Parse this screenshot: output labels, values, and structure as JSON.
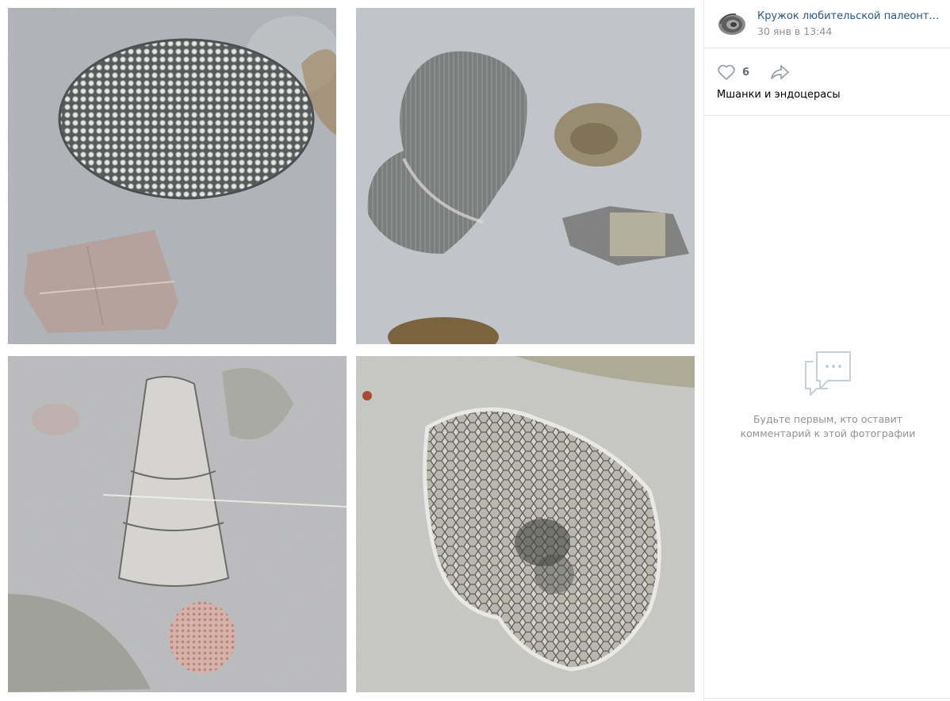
{
  "post": {
    "author": "Кружок любительской палеонтоло...",
    "date": "30 янв в 13:44",
    "likes": "6",
    "caption": "Мшанки и эндоцерасы"
  },
  "comments": {
    "empty_text": "Будьте первым, кто оставит комментарий к этой фотографии"
  },
  "icons": {
    "like": "heart-icon",
    "share": "share-arrow-icon",
    "comments_empty": "chat-bubble-icon",
    "avatar": "ammonite-avatar"
  },
  "colors": {
    "link": "#2a5885",
    "muted": "#939393",
    "icon": "#99a2ad",
    "divider": "#e7e8ec",
    "rock": "#b9bcc0",
    "fossil_dark": "#6b6d6c"
  },
  "photos": [
    {
      "subject": "bryozoan colony, round"
    },
    {
      "subject": "shell fossil"
    },
    {
      "subject": "endoceras cone"
    },
    {
      "subject": "bryozoan colony, irregular"
    }
  ]
}
